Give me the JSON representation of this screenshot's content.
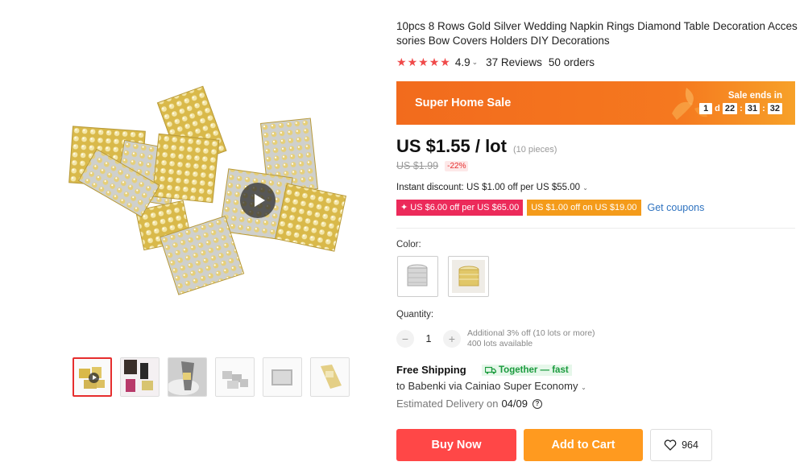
{
  "product": {
    "title": "10pcs 8 Rows Gold Silver Wedding Napkin Rings Diamond Table Decoration Accessories Bow Covers Holders DIY Decorations",
    "rating": "4.9",
    "rating_caret": "⌄",
    "reviews": "37 Reviews",
    "orders": "50 orders"
  },
  "sale_banner": {
    "title": "Super Home Sale",
    "ends_label": "Sale ends in",
    "days": "1",
    "days_unit": "d",
    "hours": "22",
    "minutes": "31",
    "seconds": "32",
    "separator": ":"
  },
  "pricing": {
    "price": "US $1.55 / lot",
    "price_note": "(10 pieces)",
    "original_price": "US $1.99",
    "discount": "-22%",
    "instant_discount": "Instant discount: US $1.00 off per US $55.00",
    "coupon_1": "✦ US $6.00 off per US $65.00",
    "coupon_2": "US $1.00 off on US $19.00",
    "get_coupons": "Get coupons"
  },
  "options": {
    "color_label": "Color:",
    "quantity_label": "Quantity:",
    "minus": "−",
    "plus": "+",
    "quantity": "1",
    "qty_discount": "Additional 3% off (10 lots or more)",
    "available": "400 lots available"
  },
  "shipping": {
    "title": "Free Shipping",
    "badge": "Together — fast",
    "via": "to Babenki via Cainiao Super Economy",
    "delivery_label": "Estimated Delivery on",
    "delivery_date": "04/09",
    "help": "?"
  },
  "actions": {
    "buy_now": "Buy Now",
    "add_to_cart": "Add to Cart",
    "wishlist_count": "964"
  },
  "colors": {
    "accent_red": "#ff4747",
    "accent_orange": "#ff9a1f",
    "sale_orange": "#f26b1d",
    "coupon_pink": "#ec2a5a",
    "link_blue": "#2f73c0",
    "ship_green": "#1b9b3e"
  },
  "icons": [
    "star-icon",
    "play-icon",
    "heart-icon",
    "help-icon",
    "truck-icon",
    "caret-icon"
  ]
}
